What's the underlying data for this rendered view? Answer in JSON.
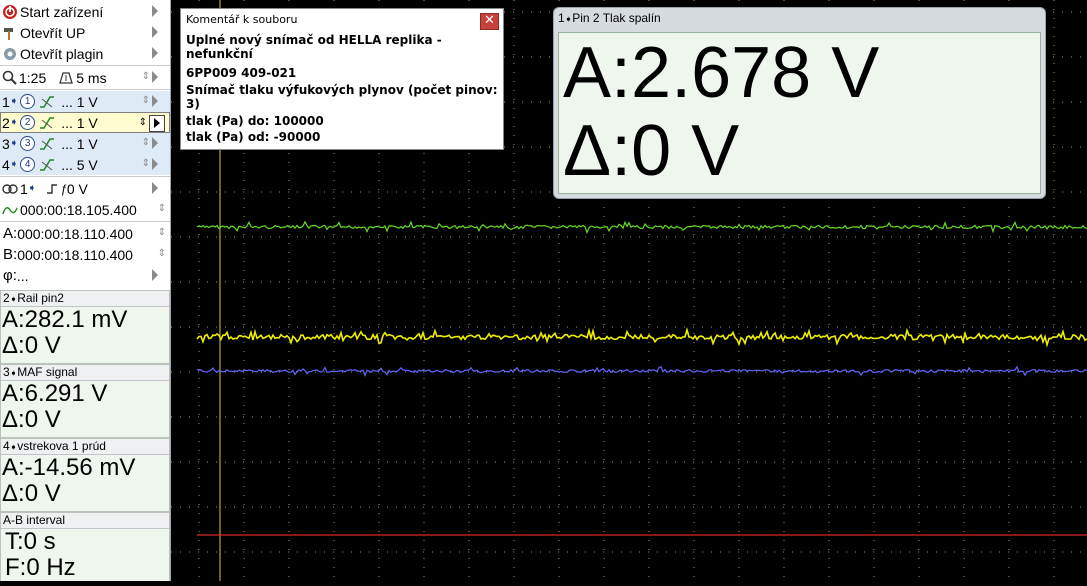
{
  "sidebar": {
    "start_label": "Start zařízení",
    "open_up_label": "Otevřít UP",
    "open_plugin_label": "Otevřít plagin",
    "zoom": "1:25",
    "timebase": "5 ms",
    "channels": [
      {
        "num": "1",
        "value": "... 1 V"
      },
      {
        "num": "2",
        "value": "... 1 V"
      },
      {
        "num": "3",
        "value": "... 1 V"
      },
      {
        "num": "4",
        "value": "... 5 V"
      }
    ],
    "trigger_channel": "1",
    "trigger_level": "0 V",
    "time_position": "000:00:18.105.400",
    "cursor_a": "000:00:18.110.400",
    "cursor_b": "000:00:18.110.400",
    "phase": "...",
    "a_prefix": "A:",
    "b_prefix": "B:",
    "phi_prefix": "φ:"
  },
  "measurements": [
    {
      "header": "Rail pin2",
      "num": "2",
      "a": "A:282.1 mV",
      "delta": "Δ:0 V"
    },
    {
      "header": "MAF signal",
      "num": "3",
      "a": "A:6.291 V",
      "delta": "Δ:0 V"
    },
    {
      "header": "vstrekova 1 prúd",
      "num": "4",
      "a": "A:-14.56 mV",
      "delta": "Δ:0 V"
    }
  ],
  "ab_interval": {
    "header": "A-B interval",
    "t": "T:0 s",
    "f": "F:0 Hz"
  },
  "comment": {
    "title": "Komentář k souboru",
    "line1": "Uplné nový snímač od HELLA replika - nefunkční",
    "line2": "6PP009 409-021",
    "line3": "Snímač tlaku výfukových plynov (počet pinov: 3)",
    "line4": "tlak (Pa) do: 100000",
    "line5": "tlak (Pa) od: -90000"
  },
  "meter": {
    "header_num": "1",
    "header": "Pin 2 Tlak spalín",
    "value_a": "A:2.678 V",
    "value_delta": "Δ:0 V"
  },
  "traces": [
    {
      "label": "1",
      "color": "#66dd22"
    },
    {
      "label": "2",
      "color": "#6666ff"
    },
    {
      "label": "3",
      "color": "#eeee00"
    },
    {
      "label": "4",
      "color": "#dd2a2a"
    }
  ]
}
